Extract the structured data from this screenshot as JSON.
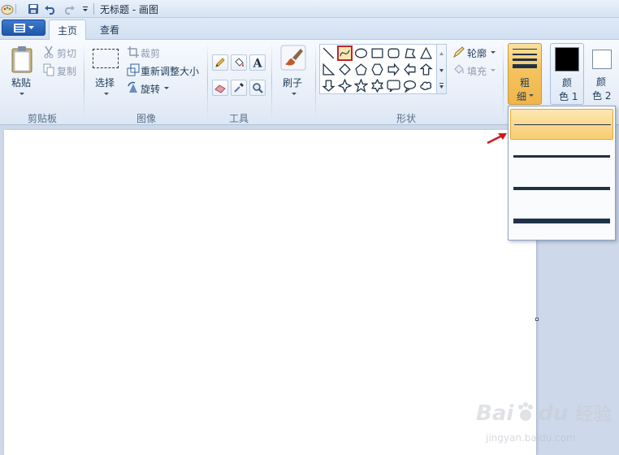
{
  "window": {
    "title": "无标题 - 画图"
  },
  "tabs": [
    {
      "label": "主页"
    },
    {
      "label": "查看"
    }
  ],
  "groups": {
    "clipboard": {
      "label": "剪贴板",
      "paste_label": "粘贴",
      "cut_label": "剪切",
      "copy_label": "复制"
    },
    "image": {
      "label": "图像",
      "select_label": "选择",
      "crop_label": "裁剪",
      "resize_label": "重新调整大小",
      "rotate_label": "旋转"
    },
    "tools": {
      "label": "工具",
      "icons": [
        "pencil-icon",
        "fill-bucket-icon",
        "text-icon",
        "eraser-icon",
        "color-picker-icon",
        "magnifier-icon"
      ]
    },
    "brushes": {
      "label": "刷子"
    },
    "shapes": {
      "label": "形状",
      "outline_label": "轮廓",
      "fill_label": "填充",
      "items": [
        "line",
        "curve",
        "oval",
        "rectangle",
        "rounded-rectangle",
        "polygon",
        "triangle",
        "right-triangle",
        "diamond",
        "pentagon",
        "hexagon",
        "right-arrow",
        "left-arrow",
        "up-arrow",
        "down-arrow",
        "four-point-star",
        "five-point-star",
        "six-point-star",
        "rounded-callout",
        "oval-callout",
        "cloud-callout"
      ],
      "selected": "curve"
    },
    "size": {
      "label_line1": "粗",
      "label_line2": "细",
      "options": [
        1,
        3,
        5,
        8
      ],
      "selected_index": 0
    },
    "color1": {
      "label_line1": "颜",
      "label_line2": "色 1",
      "color": "#000000"
    },
    "color2": {
      "label_line1": "颜",
      "label_line2": "色 2",
      "color": "#ffffff"
    }
  },
  "watermark": {
    "brand": "Bai",
    "brand2": "du",
    "cn": "经验",
    "url": "jingyan.baidu.com"
  },
  "colors": {
    "accent_orange": "#f4c25e",
    "highlight_red": "#c0262b",
    "ribbon_bg": "#e7eef8"
  }
}
